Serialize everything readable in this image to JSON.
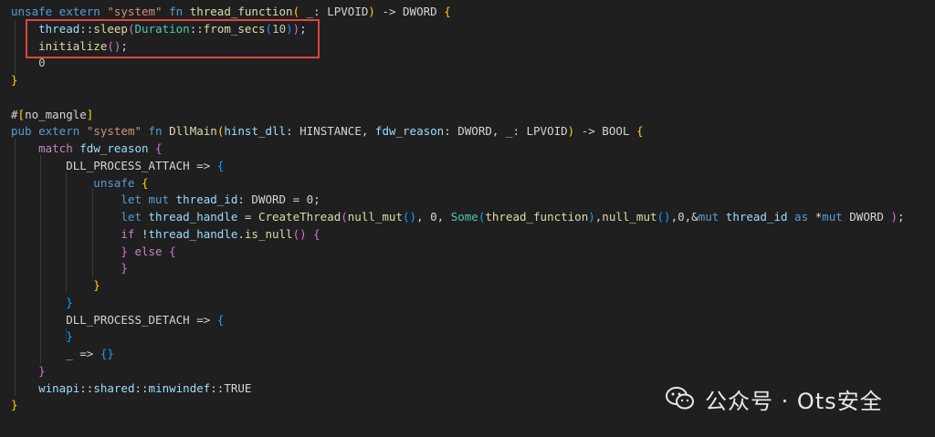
{
  "watermark": {
    "text": "公众号 · Ots安全",
    "icon": "wechat-icon"
  },
  "code_lines": [
    [
      [
        "k",
        "unsafe extern "
      ],
      [
        "s",
        "\"system\""
      ],
      [
        "k",
        " fn "
      ],
      [
        "f",
        "thread_function"
      ],
      [
        "b1",
        "("
      ],
      [
        "v",
        " _"
      ],
      [
        "p",
        ": LPVOID"
      ],
      [
        "b1",
        ")"
      ],
      [
        "p",
        " -> DWORD "
      ],
      [
        "b1",
        "{"
      ]
    ],
    [
      [
        "v",
        "    thread"
      ],
      [
        "p",
        "::"
      ],
      [
        "f",
        "sleep"
      ],
      [
        "b2",
        "("
      ],
      [
        "t",
        "Duration"
      ],
      [
        "p",
        "::"
      ],
      [
        "f",
        "from_secs"
      ],
      [
        "b3",
        "("
      ],
      [
        "n",
        "10"
      ],
      [
        "b3",
        ")"
      ],
      [
        "b2",
        ")"
      ],
      [
        "p",
        ";"
      ]
    ],
    [
      [
        "f",
        "    initialize"
      ],
      [
        "b2",
        "()"
      ],
      [
        "p",
        ";"
      ]
    ],
    [
      [
        "n",
        "    0"
      ]
    ],
    [
      [
        "b1",
        "}"
      ]
    ],
    [
      [
        "p",
        ""
      ]
    ],
    [
      [
        "p",
        "#"
      ],
      [
        "b1",
        "["
      ],
      [
        "p",
        "no_mangle"
      ],
      [
        "b1",
        "]"
      ]
    ],
    [
      [
        "k",
        "pub extern "
      ],
      [
        "s",
        "\"system\""
      ],
      [
        "k",
        " fn "
      ],
      [
        "f",
        "DllMain"
      ],
      [
        "b1",
        "("
      ],
      [
        "v",
        "hinst_dll"
      ],
      [
        "p",
        ": HINSTANCE, "
      ],
      [
        "v",
        "fdw_reason"
      ],
      [
        "p",
        ": DWORD, "
      ],
      [
        "v",
        "_"
      ],
      [
        "p",
        ": LPVOID"
      ],
      [
        "b1",
        ")"
      ],
      [
        "p",
        " -> BOOL "
      ],
      [
        "b1",
        "{"
      ]
    ],
    [
      [
        "kc",
        "    match "
      ],
      [
        "v",
        "fdw_reason"
      ],
      [
        "b2",
        " {"
      ]
    ],
    [
      [
        "p",
        "        DLL_PROCESS_ATTACH => "
      ],
      [
        "b3",
        "{"
      ]
    ],
    [
      [
        "k",
        "            unsafe "
      ],
      [
        "b1",
        "{"
      ]
    ],
    [
      [
        "k",
        "                let mut "
      ],
      [
        "v",
        "thread_id"
      ],
      [
        "p",
        ": DWORD = 0;"
      ]
    ],
    [
      [
        "k",
        "                let "
      ],
      [
        "v",
        "thread_handle"
      ],
      [
        "p",
        " = "
      ],
      [
        "f",
        "CreateThread"
      ],
      [
        "b2",
        "("
      ],
      [
        "f",
        "null_mut"
      ],
      [
        "b3",
        "()"
      ],
      [
        "p",
        ", 0, "
      ],
      [
        "t",
        "Some"
      ],
      [
        "b3",
        "("
      ],
      [
        "f",
        "thread_function"
      ],
      [
        "b3",
        ")"
      ],
      [
        "p",
        ","
      ],
      [
        "f",
        "null_mut"
      ],
      [
        "b3",
        "()"
      ],
      [
        "p",
        ",0,&"
      ],
      [
        "k",
        "mut "
      ],
      [
        "v",
        "thread_id"
      ],
      [
        "k",
        " as "
      ],
      [
        "p",
        "*"
      ],
      [
        "k",
        "mut"
      ],
      [
        "p",
        " DWORD "
      ],
      [
        "b2",
        ")"
      ],
      [
        "p",
        ";"
      ]
    ],
    [
      [
        "kc",
        "                if "
      ],
      [
        "p",
        "!"
      ],
      [
        "v",
        "thread_handle"
      ],
      [
        "p",
        "."
      ],
      [
        "f",
        "is_null"
      ],
      [
        "b2",
        "()"
      ],
      [
        "b2",
        " {"
      ]
    ],
    [
      [
        "b2",
        "                }"
      ],
      [
        "kc",
        " else "
      ],
      [
        "b2",
        "{"
      ]
    ],
    [
      [
        "b2",
        "                }"
      ]
    ],
    [
      [
        "b1",
        "            }"
      ]
    ],
    [
      [
        "b3",
        "        }"
      ]
    ],
    [
      [
        "p",
        "        DLL_PROCESS_DETACH => "
      ],
      [
        "b3",
        "{"
      ]
    ],
    [
      [
        "b3",
        "        }"
      ]
    ],
    [
      [
        "p",
        "        _ => "
      ],
      [
        "b3",
        "{}"
      ]
    ],
    [
      [
        "b2",
        "    }"
      ]
    ],
    [
      [
        "v",
        "    winapi"
      ],
      [
        "p",
        "::"
      ],
      [
        "v",
        "shared"
      ],
      [
        "p",
        "::"
      ],
      [
        "v",
        "minwindef"
      ],
      [
        "p",
        "::TRUE"
      ]
    ],
    [
      [
        "b1",
        "}"
      ]
    ]
  ]
}
